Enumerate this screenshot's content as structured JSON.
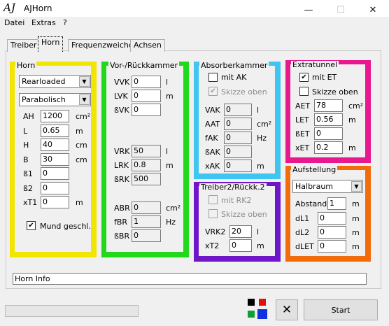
{
  "window": {
    "title": "AJHorn",
    "logo": "AJ",
    "controls": {
      "min": "—",
      "max": "☐",
      "close": "✕"
    }
  },
  "menu": [
    "Datei",
    "Extras",
    "?"
  ],
  "tabs": [
    "Treiber",
    "Horn",
    "Frequenzweiche",
    "Achsen"
  ],
  "horn": {
    "legend": "Horn",
    "type": "Rearloaded",
    "shape": "Parabolisch",
    "fields": [
      [
        "AH",
        "1200",
        "cm²"
      ],
      [
        "L",
        "0.65",
        "m"
      ],
      [
        "H",
        "40",
        "cm"
      ],
      [
        "B",
        "30",
        "cm"
      ],
      [
        "ß1",
        "0",
        ""
      ],
      [
        "ß2",
        "0",
        ""
      ],
      [
        "xT1",
        "0",
        "m"
      ]
    ],
    "mund_label": "Mund geschl.",
    "mund_checked": "✔"
  },
  "vor": {
    "legend": "Vor-/Rückkammer",
    "g1": [
      [
        "VVK",
        "0",
        "l"
      ],
      [
        "LVK",
        "0",
        "m"
      ],
      [
        "ßVK",
        "0",
        ""
      ]
    ],
    "g2": [
      [
        "VRK",
        "50",
        "l"
      ],
      [
        "LRK",
        "0.8",
        "m"
      ],
      [
        "ßRK",
        "500",
        ""
      ]
    ],
    "g3": [
      [
        "ABR",
        "0",
        "cm²"
      ],
      [
        "fBR",
        "1",
        "Hz"
      ],
      [
        "ßBR",
        "0",
        ""
      ]
    ]
  },
  "absorber": {
    "legend": "Absorberkammer",
    "check1": "mit AK",
    "check2": "Skizze oben",
    "check2_mark": "✔",
    "fields": [
      [
        "VAK",
        "0",
        "l"
      ],
      [
        "AAT",
        "0",
        "cm²"
      ],
      [
        "fAK",
        "0",
        "Hz"
      ],
      [
        "ßAK",
        "0",
        ""
      ],
      [
        "xAK",
        "0",
        "m"
      ]
    ]
  },
  "treiber2": {
    "legend": "Treiber2/Rückk.2",
    "check1": "mit RK2",
    "check2": "Skizze oben",
    "fields": [
      [
        "VRK2",
        "20",
        "l"
      ],
      [
        "xT2",
        "0",
        "m"
      ]
    ]
  },
  "extratunnel": {
    "legend": "Extratunnel",
    "check1": "mit ET",
    "check1_mark": "✔",
    "check2": "Skizze oben",
    "fields": [
      [
        "AET",
        "78",
        "cm²"
      ],
      [
        "LET",
        "0.56",
        "m"
      ],
      [
        "ßET",
        "0",
        ""
      ],
      [
        "xET",
        "0.2",
        "m"
      ]
    ]
  },
  "aufstellung": {
    "legend": "Aufstellung",
    "select": "Halbraum",
    "abstand": [
      "Abstand",
      "1",
      "m"
    ],
    "fields": [
      [
        "dL1",
        "0",
        "m"
      ],
      [
        "dL2",
        "0",
        "m"
      ],
      [
        "dLET",
        "0",
        "m"
      ]
    ]
  },
  "info": "Horn Info",
  "start_label": "Start",
  "colors": {
    "horn": "#f2e600",
    "vor": "#22d81a",
    "absorber": "#3ec5f0",
    "treiber2": "#6e16c8",
    "extratunnel": "#e8188e",
    "aufstellung": "#f26c0c"
  }
}
